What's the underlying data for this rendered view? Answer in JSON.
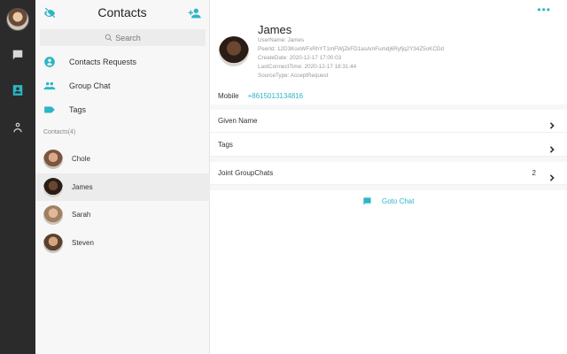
{
  "header": {
    "title": "Contacts"
  },
  "search": {
    "placeholder": "Search"
  },
  "menu": [
    {
      "label": "Contacts Requests",
      "icon": "contact-request-icon"
    },
    {
      "label": "Group Chat",
      "icon": "group-icon"
    },
    {
      "label": "Tags",
      "icon": "tag-icon"
    }
  ],
  "contacts_section": {
    "label": "Contacts(4)"
  },
  "contacts": [
    {
      "name": "Chole"
    },
    {
      "name": "James"
    },
    {
      "name": "Sarah"
    },
    {
      "name": "Steven"
    }
  ],
  "detail": {
    "name": "James",
    "username": "UserName: James",
    "peerid": "PeerId: 12D3KooWFxRhYT1mFWjZkFD1asAmFumdj6Ryfjq2Y34Z5oKCDd",
    "create_date": "CreateDate: 2020-12-17 17:00:03",
    "last_connect": "LastConnectTime: 2020-12-17 18:31:44",
    "source_type": "SourceType: AcceptRequest",
    "mobile_label": "Mobile",
    "mobile_value": "+8615013134816",
    "given_name_label": "Given Name",
    "tags_label": "Tags",
    "joint_groups_label": "Joint GroupChats",
    "joint_groups_count": "2",
    "goto_chat_label": "Goto Chat",
    "more_label": "•••"
  },
  "colors": {
    "accent": "#2bb6c5",
    "rail": "#2b2b2b"
  }
}
